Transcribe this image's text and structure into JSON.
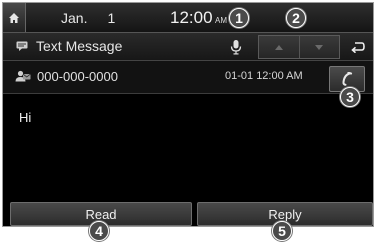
{
  "status": {
    "date_month": "Jan.",
    "date_day": "1",
    "time": "12:00",
    "ampm": "AM"
  },
  "header": {
    "title": "Text Message"
  },
  "message": {
    "sender": "000-000-0000",
    "timestamp": "01-01 12:00 AM",
    "body": "Hi"
  },
  "actions": {
    "read": "Read",
    "reply": "Reply"
  },
  "callouts": [
    "1",
    "2",
    "3",
    "4",
    "5"
  ],
  "icons": {
    "home": "home-icon",
    "message": "message-icon",
    "mic": "mic-icon",
    "prev": "arrow-up-icon",
    "next": "arrow-down-icon",
    "back": "back-icon",
    "contact": "person-icon",
    "call": "phone-icon"
  },
  "colors": {
    "background": "#000000",
    "text": "#f0f0f0",
    "button": "#3a3a3a",
    "callout": "#4a4a4a"
  }
}
